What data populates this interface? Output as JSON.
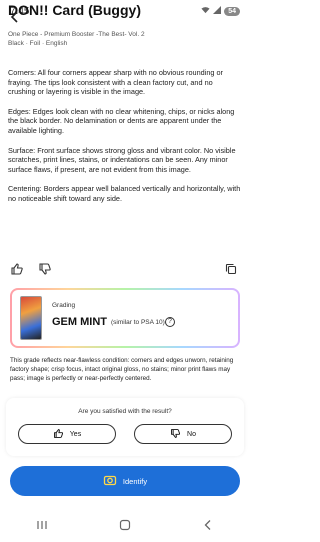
{
  "status_bar": {
    "time": "7:45",
    "battery": "54"
  },
  "header": {
    "title": "DON!! Card (Buggy)",
    "subtitle_line1": "One Piece - Premium Booster -The Best- Vol. 2",
    "subtitle_line2": "Black · Foil · English"
  },
  "details": {
    "corners_label": "Corners",
    "corners_text": ": All four corners appear sharp with no obvious rounding or fraying. The tips look consistent with a clean factory cut, and no crushing or layering is visible in the image.",
    "edges_label": "Edges",
    "edges_text": ": Edges look clean with no clear whitening, chips, or nicks along the black border. No delamination or dents are apparent under the available lighting.",
    "surface_label": "Surface",
    "surface_text": ": Front surface shows strong gloss and vibrant color. No visible scratches, print lines, stains, or indentations can be seen. Any minor surface flaws, if present, are not evident from this image.",
    "centering_label": "Centering",
    "centering_text": ": Borders appear well balanced vertically and horizontally, with no noticeable shift toward any side."
  },
  "grading": {
    "label": "Grading",
    "value": "GEM MINT",
    "note": "(similar to PSA 10)"
  },
  "summary": "This grade reflects near-flawless condition: corners and edges unworn, retaining factory shape; crisp focus, intact original gloss, no stains; minor print flaws may pass; image is perfectly or near-perfectly centered.",
  "satisfaction": {
    "question": "Are you satisfied with the result?",
    "yes_label": "Yes",
    "no_label": "No"
  },
  "identify_label": "Identify",
  "colors": {
    "primary": "#1e6fd8"
  }
}
